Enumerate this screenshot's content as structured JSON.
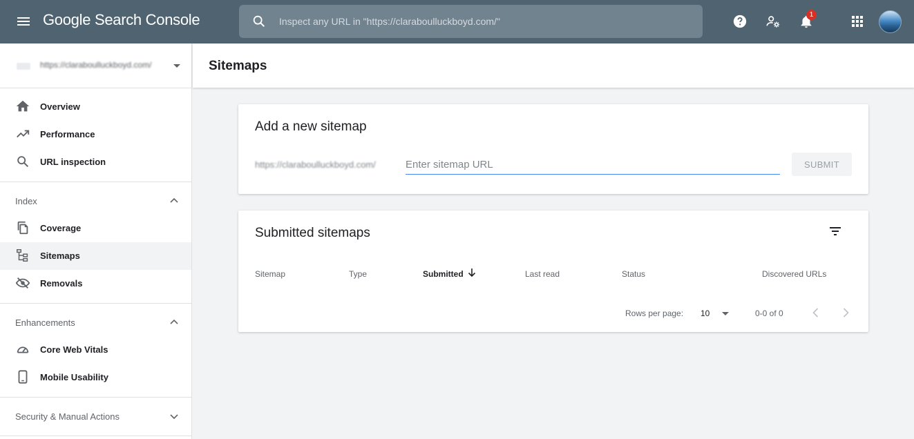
{
  "topbar": {
    "brand": "Google Search Console",
    "search_placeholder": "Inspect any URL in \"https://claraboulluckboyd.com/\"",
    "notification_count": "1",
    "icons": [
      "menu-icon",
      "search-icon",
      "help-icon",
      "admin-icon",
      "bell-icon",
      "apps-icon",
      "avatar"
    ]
  },
  "sidebar": {
    "property_url": "https://claraboulluckboyd.com/",
    "top_items": [
      {
        "label": "Overview",
        "icon": "home-icon"
      },
      {
        "label": "Performance",
        "icon": "trending-icon"
      },
      {
        "label": "URL inspection",
        "icon": "search-icon"
      }
    ],
    "index": {
      "label": "Index",
      "items": [
        {
          "label": "Coverage",
          "icon": "copy-icon"
        },
        {
          "label": "Sitemaps",
          "icon": "sitemap-icon",
          "active": true
        },
        {
          "label": "Removals",
          "icon": "eye-off-icon"
        }
      ]
    },
    "enhancements": {
      "label": "Enhancements",
      "items": [
        {
          "label": "Core Web Vitals",
          "icon": "gauge-icon"
        },
        {
          "label": "Mobile Usability",
          "icon": "phone-icon"
        }
      ]
    },
    "security": {
      "label": "Security & Manual Actions"
    }
  },
  "page": {
    "title": "Sitemaps"
  },
  "add_card": {
    "title": "Add a new sitemap",
    "base_url": "https://claraboulluckboyd.com/",
    "input_placeholder": "Enter sitemap URL",
    "submit_label": "SUBMIT"
  },
  "list_card": {
    "title": "Submitted sitemaps",
    "columns": [
      "Sitemap",
      "Type",
      "Submitted",
      "Last read",
      "Status",
      "Discovered URLs"
    ],
    "sorted_column": "Submitted",
    "rows_per_page_label": "Rows per page:",
    "rows_per_page_value": "10",
    "range_text": "0-0 of 0"
  },
  "colors": {
    "topbar": "#4f6371",
    "accent": "#4285f4",
    "badge": "#d93025"
  }
}
